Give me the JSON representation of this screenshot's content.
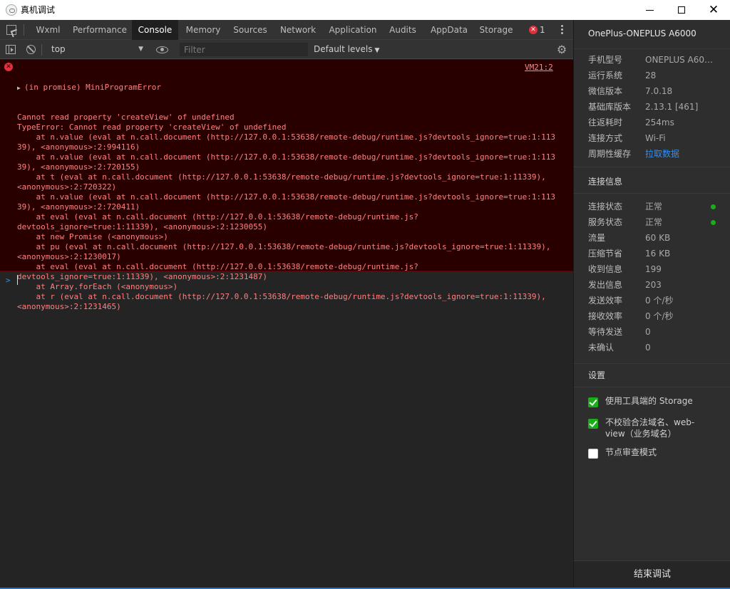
{
  "window": {
    "title": "真机调试"
  },
  "tabs": [
    "Wxml",
    "Performance",
    "Console",
    "Memory",
    "Sources",
    "Network",
    "Application",
    "Audits",
    "AppData",
    "Storage"
  ],
  "active_tab": "Console",
  "error_count": "1",
  "toolbar": {
    "context": "top",
    "filter_placeholder": "Filter",
    "levels": "Default levels"
  },
  "console": {
    "source": "VM21:2",
    "header": "(in promise) MiniProgramError",
    "lines": [
      "Cannot read property 'createView' of undefined",
      "TypeError: Cannot read property 'createView' of undefined",
      "    at n.value (eval at n.call.document (http://127.0.0.1:53638/remote-debug/runtime.js?devtools_ignore=true:1:113",
      "39), <anonymous>:2:994116)",
      "    at n.value (eval at n.call.document (http://127.0.0.1:53638/remote-debug/runtime.js?devtools_ignore=true:1:113",
      "39), <anonymous>:2:720155)",
      "    at t (eval at n.call.document (http://127.0.0.1:53638/remote-debug/runtime.js?devtools_ignore=true:1:11339),",
      "<anonymous>:2:720322)",
      "    at n.value (eval at n.call.document (http://127.0.0.1:53638/remote-debug/runtime.js?devtools_ignore=true:1:113",
      "39), <anonymous>:2:720411)",
      "    at eval (eval at n.call.document (http://127.0.0.1:53638/remote-debug/runtime.js?",
      "devtools_ignore=true:1:11339), <anonymous>:2:1230055)",
      "    at new Promise (<anonymous>)",
      "    at pu (eval at n.call.document (http://127.0.0.1:53638/remote-debug/runtime.js?devtools_ignore=true:1:11339),",
      "<anonymous>:2:1230017)",
      "    at eval (eval at n.call.document (http://127.0.0.1:53638/remote-debug/runtime.js?",
      "devtools_ignore=true:1:11339), <anonymous>:2:1231487)",
      "    at Array.forEach (<anonymous>)",
      "    at r (eval at n.call.document (http://127.0.0.1:53638/remote-debug/runtime.js?devtools_ignore=true:1:11339),",
      "<anonymous>:2:1231465)"
    ]
  },
  "device": {
    "name": "OnePlus-ONEPLUS A6000",
    "info": [
      {
        "k": "手机型号",
        "v": "ONEPLUS A6000..."
      },
      {
        "k": "运行系统",
        "v": "28"
      },
      {
        "k": "微信版本",
        "v": "7.0.18"
      },
      {
        "k": "基础库版本",
        "v": "2.13.1 [461]"
      },
      {
        "k": "往返耗时",
        "v": "254ms"
      },
      {
        "k": "连接方式",
        "v": "Wi-Fi"
      },
      {
        "k": "周期性缓存",
        "v": "拉取数据"
      }
    ],
    "conn_title": "连接信息",
    "conn": [
      {
        "k": "连接状态",
        "v": "正常"
      },
      {
        "k": "服务状态",
        "v": "正常"
      },
      {
        "k": "流量",
        "v": "60 KB"
      },
      {
        "k": "压缩节省",
        "v": "16 KB"
      },
      {
        "k": "收到信息",
        "v": "199"
      },
      {
        "k": "发出信息",
        "v": "203"
      },
      {
        "k": "发送效率",
        "v": "0 个/秒"
      },
      {
        "k": "接收效率",
        "v": "0 个/秒"
      },
      {
        "k": "等待发送",
        "v": "0"
      },
      {
        "k": "未确认",
        "v": "0"
      }
    ],
    "settings_title": "设置",
    "settings": [
      {
        "label": "使用工具端的 Storage",
        "checked": true
      },
      {
        "label": "不校验合法域名、web-view（业务域名）",
        "checked": true
      },
      {
        "label": "节点审查模式",
        "checked": false
      }
    ],
    "end_button": "结束调试"
  },
  "colors": {
    "accent": "#1aad19",
    "error": "#ff8080",
    "link": "#3b8ce8"
  }
}
